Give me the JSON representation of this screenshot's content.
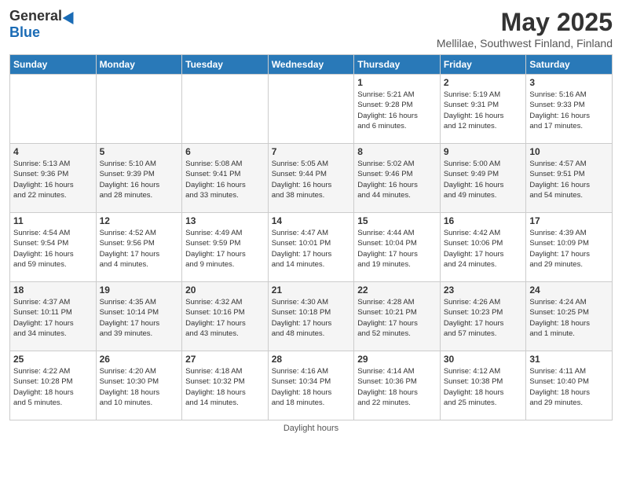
{
  "header": {
    "logo_general": "General",
    "logo_blue": "Blue",
    "title": "May 2025",
    "subtitle": "Mellilae, Southwest Finland, Finland"
  },
  "weekdays": [
    "Sunday",
    "Monday",
    "Tuesday",
    "Wednesday",
    "Thursday",
    "Friday",
    "Saturday"
  ],
  "footer": {
    "daylight_label": "Daylight hours"
  },
  "weeks": [
    [
      {
        "day": "",
        "info": ""
      },
      {
        "day": "",
        "info": ""
      },
      {
        "day": "",
        "info": ""
      },
      {
        "day": "",
        "info": ""
      },
      {
        "day": "1",
        "info": "Sunrise: 5:21 AM\nSunset: 9:28 PM\nDaylight: 16 hours\nand 6 minutes."
      },
      {
        "day": "2",
        "info": "Sunrise: 5:19 AM\nSunset: 9:31 PM\nDaylight: 16 hours\nand 12 minutes."
      },
      {
        "day": "3",
        "info": "Sunrise: 5:16 AM\nSunset: 9:33 PM\nDaylight: 16 hours\nand 17 minutes."
      }
    ],
    [
      {
        "day": "4",
        "info": "Sunrise: 5:13 AM\nSunset: 9:36 PM\nDaylight: 16 hours\nand 22 minutes."
      },
      {
        "day": "5",
        "info": "Sunrise: 5:10 AM\nSunset: 9:39 PM\nDaylight: 16 hours\nand 28 minutes."
      },
      {
        "day": "6",
        "info": "Sunrise: 5:08 AM\nSunset: 9:41 PM\nDaylight: 16 hours\nand 33 minutes."
      },
      {
        "day": "7",
        "info": "Sunrise: 5:05 AM\nSunset: 9:44 PM\nDaylight: 16 hours\nand 38 minutes."
      },
      {
        "day": "8",
        "info": "Sunrise: 5:02 AM\nSunset: 9:46 PM\nDaylight: 16 hours\nand 44 minutes."
      },
      {
        "day": "9",
        "info": "Sunrise: 5:00 AM\nSunset: 9:49 PM\nDaylight: 16 hours\nand 49 minutes."
      },
      {
        "day": "10",
        "info": "Sunrise: 4:57 AM\nSunset: 9:51 PM\nDaylight: 16 hours\nand 54 minutes."
      }
    ],
    [
      {
        "day": "11",
        "info": "Sunrise: 4:54 AM\nSunset: 9:54 PM\nDaylight: 16 hours\nand 59 minutes."
      },
      {
        "day": "12",
        "info": "Sunrise: 4:52 AM\nSunset: 9:56 PM\nDaylight: 17 hours\nand 4 minutes."
      },
      {
        "day": "13",
        "info": "Sunrise: 4:49 AM\nSunset: 9:59 PM\nDaylight: 17 hours\nand 9 minutes."
      },
      {
        "day": "14",
        "info": "Sunrise: 4:47 AM\nSunset: 10:01 PM\nDaylight: 17 hours\nand 14 minutes."
      },
      {
        "day": "15",
        "info": "Sunrise: 4:44 AM\nSunset: 10:04 PM\nDaylight: 17 hours\nand 19 minutes."
      },
      {
        "day": "16",
        "info": "Sunrise: 4:42 AM\nSunset: 10:06 PM\nDaylight: 17 hours\nand 24 minutes."
      },
      {
        "day": "17",
        "info": "Sunrise: 4:39 AM\nSunset: 10:09 PM\nDaylight: 17 hours\nand 29 minutes."
      }
    ],
    [
      {
        "day": "18",
        "info": "Sunrise: 4:37 AM\nSunset: 10:11 PM\nDaylight: 17 hours\nand 34 minutes."
      },
      {
        "day": "19",
        "info": "Sunrise: 4:35 AM\nSunset: 10:14 PM\nDaylight: 17 hours\nand 39 minutes."
      },
      {
        "day": "20",
        "info": "Sunrise: 4:32 AM\nSunset: 10:16 PM\nDaylight: 17 hours\nand 43 minutes."
      },
      {
        "day": "21",
        "info": "Sunrise: 4:30 AM\nSunset: 10:18 PM\nDaylight: 17 hours\nand 48 minutes."
      },
      {
        "day": "22",
        "info": "Sunrise: 4:28 AM\nSunset: 10:21 PM\nDaylight: 17 hours\nand 52 minutes."
      },
      {
        "day": "23",
        "info": "Sunrise: 4:26 AM\nSunset: 10:23 PM\nDaylight: 17 hours\nand 57 minutes."
      },
      {
        "day": "24",
        "info": "Sunrise: 4:24 AM\nSunset: 10:25 PM\nDaylight: 18 hours\nand 1 minute."
      }
    ],
    [
      {
        "day": "25",
        "info": "Sunrise: 4:22 AM\nSunset: 10:28 PM\nDaylight: 18 hours\nand 5 minutes."
      },
      {
        "day": "26",
        "info": "Sunrise: 4:20 AM\nSunset: 10:30 PM\nDaylight: 18 hours\nand 10 minutes."
      },
      {
        "day": "27",
        "info": "Sunrise: 4:18 AM\nSunset: 10:32 PM\nDaylight: 18 hours\nand 14 minutes."
      },
      {
        "day": "28",
        "info": "Sunrise: 4:16 AM\nSunset: 10:34 PM\nDaylight: 18 hours\nand 18 minutes."
      },
      {
        "day": "29",
        "info": "Sunrise: 4:14 AM\nSunset: 10:36 PM\nDaylight: 18 hours\nand 22 minutes."
      },
      {
        "day": "30",
        "info": "Sunrise: 4:12 AM\nSunset: 10:38 PM\nDaylight: 18 hours\nand 25 minutes."
      },
      {
        "day": "31",
        "info": "Sunrise: 4:11 AM\nSunset: 10:40 PM\nDaylight: 18 hours\nand 29 minutes."
      }
    ]
  ]
}
